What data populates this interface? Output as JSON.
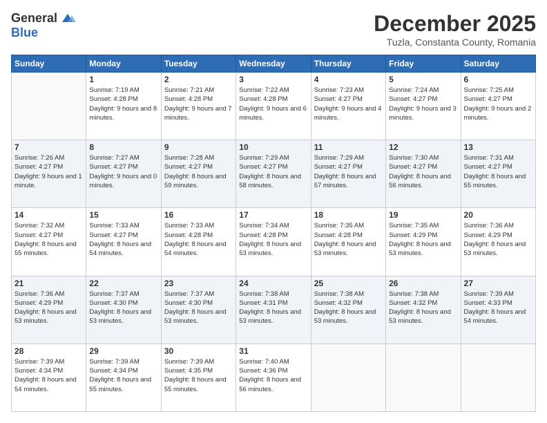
{
  "logo": {
    "general": "General",
    "blue": "Blue"
  },
  "title": "December 2025",
  "subtitle": "Tuzla, Constanta County, Romania",
  "weekdays": [
    "Sunday",
    "Monday",
    "Tuesday",
    "Wednesday",
    "Thursday",
    "Friday",
    "Saturday"
  ],
  "weeks": [
    [
      {
        "day": "",
        "sunrise": "",
        "sunset": "",
        "daylight": ""
      },
      {
        "day": "1",
        "sunrise": "Sunrise: 7:19 AM",
        "sunset": "Sunset: 4:28 PM",
        "daylight": "Daylight: 9 hours and 8 minutes."
      },
      {
        "day": "2",
        "sunrise": "Sunrise: 7:21 AM",
        "sunset": "Sunset: 4:28 PM",
        "daylight": "Daylight: 9 hours and 7 minutes."
      },
      {
        "day": "3",
        "sunrise": "Sunrise: 7:22 AM",
        "sunset": "Sunset: 4:28 PM",
        "daylight": "Daylight: 9 hours and 6 minutes."
      },
      {
        "day": "4",
        "sunrise": "Sunrise: 7:23 AM",
        "sunset": "Sunset: 4:27 PM",
        "daylight": "Daylight: 9 hours and 4 minutes."
      },
      {
        "day": "5",
        "sunrise": "Sunrise: 7:24 AM",
        "sunset": "Sunset: 4:27 PM",
        "daylight": "Daylight: 9 hours and 3 minutes."
      },
      {
        "day": "6",
        "sunrise": "Sunrise: 7:25 AM",
        "sunset": "Sunset: 4:27 PM",
        "daylight": "Daylight: 9 hours and 2 minutes."
      }
    ],
    [
      {
        "day": "7",
        "sunrise": "Sunrise: 7:26 AM",
        "sunset": "Sunset: 4:27 PM",
        "daylight": "Daylight: 9 hours and 1 minute."
      },
      {
        "day": "8",
        "sunrise": "Sunrise: 7:27 AM",
        "sunset": "Sunset: 4:27 PM",
        "daylight": "Daylight: 9 hours and 0 minutes."
      },
      {
        "day": "9",
        "sunrise": "Sunrise: 7:28 AM",
        "sunset": "Sunset: 4:27 PM",
        "daylight": "Daylight: 8 hours and 59 minutes."
      },
      {
        "day": "10",
        "sunrise": "Sunrise: 7:29 AM",
        "sunset": "Sunset: 4:27 PM",
        "daylight": "Daylight: 8 hours and 58 minutes."
      },
      {
        "day": "11",
        "sunrise": "Sunrise: 7:29 AM",
        "sunset": "Sunset: 4:27 PM",
        "daylight": "Daylight: 8 hours and 57 minutes."
      },
      {
        "day": "12",
        "sunrise": "Sunrise: 7:30 AM",
        "sunset": "Sunset: 4:27 PM",
        "daylight": "Daylight: 8 hours and 56 minutes."
      },
      {
        "day": "13",
        "sunrise": "Sunrise: 7:31 AM",
        "sunset": "Sunset: 4:27 PM",
        "daylight": "Daylight: 8 hours and 55 minutes."
      }
    ],
    [
      {
        "day": "14",
        "sunrise": "Sunrise: 7:32 AM",
        "sunset": "Sunset: 4:27 PM",
        "daylight": "Daylight: 8 hours and 55 minutes."
      },
      {
        "day": "15",
        "sunrise": "Sunrise: 7:33 AM",
        "sunset": "Sunset: 4:27 PM",
        "daylight": "Daylight: 8 hours and 54 minutes."
      },
      {
        "day": "16",
        "sunrise": "Sunrise: 7:33 AM",
        "sunset": "Sunset: 4:28 PM",
        "daylight": "Daylight: 8 hours and 54 minutes."
      },
      {
        "day": "17",
        "sunrise": "Sunrise: 7:34 AM",
        "sunset": "Sunset: 4:28 PM",
        "daylight": "Daylight: 8 hours and 53 minutes."
      },
      {
        "day": "18",
        "sunrise": "Sunrise: 7:35 AM",
        "sunset": "Sunset: 4:28 PM",
        "daylight": "Daylight: 8 hours and 53 minutes."
      },
      {
        "day": "19",
        "sunrise": "Sunrise: 7:35 AM",
        "sunset": "Sunset: 4:29 PM",
        "daylight": "Daylight: 8 hours and 53 minutes."
      },
      {
        "day": "20",
        "sunrise": "Sunrise: 7:36 AM",
        "sunset": "Sunset: 4:29 PM",
        "daylight": "Daylight: 8 hours and 53 minutes."
      }
    ],
    [
      {
        "day": "21",
        "sunrise": "Sunrise: 7:36 AM",
        "sunset": "Sunset: 4:29 PM",
        "daylight": "Daylight: 8 hours and 53 minutes."
      },
      {
        "day": "22",
        "sunrise": "Sunrise: 7:37 AM",
        "sunset": "Sunset: 4:30 PM",
        "daylight": "Daylight: 8 hours and 53 minutes."
      },
      {
        "day": "23",
        "sunrise": "Sunrise: 7:37 AM",
        "sunset": "Sunset: 4:30 PM",
        "daylight": "Daylight: 8 hours and 53 minutes."
      },
      {
        "day": "24",
        "sunrise": "Sunrise: 7:38 AM",
        "sunset": "Sunset: 4:31 PM",
        "daylight": "Daylight: 8 hours and 53 minutes."
      },
      {
        "day": "25",
        "sunrise": "Sunrise: 7:38 AM",
        "sunset": "Sunset: 4:32 PM",
        "daylight": "Daylight: 8 hours and 53 minutes."
      },
      {
        "day": "26",
        "sunrise": "Sunrise: 7:38 AM",
        "sunset": "Sunset: 4:32 PM",
        "daylight": "Daylight: 8 hours and 53 minutes."
      },
      {
        "day": "27",
        "sunrise": "Sunrise: 7:39 AM",
        "sunset": "Sunset: 4:33 PM",
        "daylight": "Daylight: 8 hours and 54 minutes."
      }
    ],
    [
      {
        "day": "28",
        "sunrise": "Sunrise: 7:39 AM",
        "sunset": "Sunset: 4:34 PM",
        "daylight": "Daylight: 8 hours and 54 minutes."
      },
      {
        "day": "29",
        "sunrise": "Sunrise: 7:39 AM",
        "sunset": "Sunset: 4:34 PM",
        "daylight": "Daylight: 8 hours and 55 minutes."
      },
      {
        "day": "30",
        "sunrise": "Sunrise: 7:39 AM",
        "sunset": "Sunset: 4:35 PM",
        "daylight": "Daylight: 8 hours and 55 minutes."
      },
      {
        "day": "31",
        "sunrise": "Sunrise: 7:40 AM",
        "sunset": "Sunset: 4:36 PM",
        "daylight": "Daylight: 8 hours and 56 minutes."
      },
      {
        "day": "",
        "sunrise": "",
        "sunset": "",
        "daylight": ""
      },
      {
        "day": "",
        "sunrise": "",
        "sunset": "",
        "daylight": ""
      },
      {
        "day": "",
        "sunrise": "",
        "sunset": "",
        "daylight": ""
      }
    ]
  ]
}
